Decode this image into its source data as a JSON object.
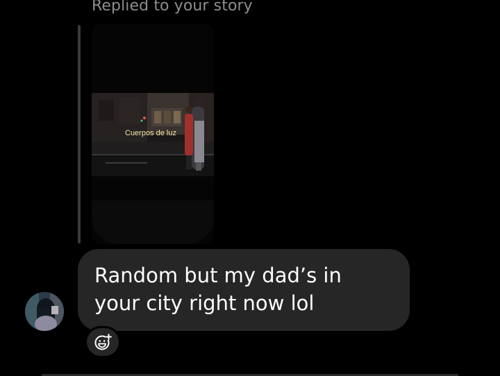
{
  "reply": {
    "header": "Replied to your story"
  },
  "story": {
    "caption": "Cuerpos de luz"
  },
  "message": {
    "text": "Random but my dad’s in your city right now lol"
  },
  "icons": {
    "react": "add-reaction-icon",
    "avatar": "profile-avatar"
  },
  "colors": {
    "background": "#000000",
    "bubble": "#262626",
    "muted_text": "#8e8e8e",
    "reply_bar": "#3a3a3a"
  }
}
